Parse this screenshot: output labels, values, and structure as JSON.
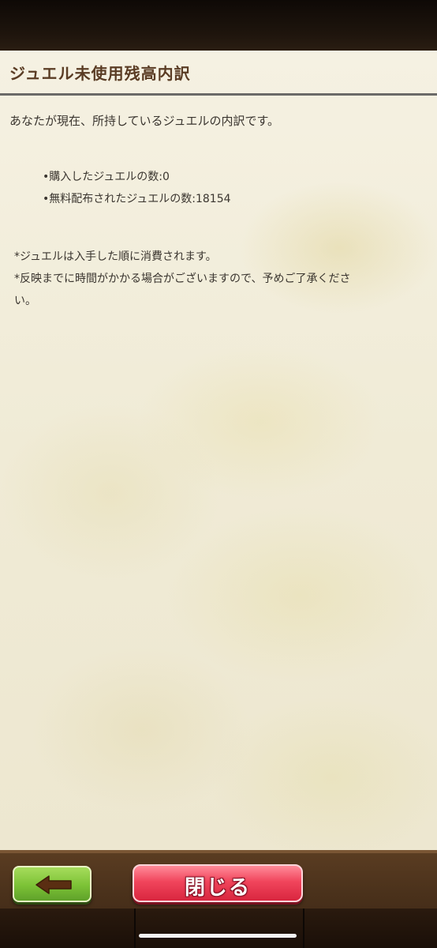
{
  "dialog": {
    "title": "ジュエル未使用残高内訳",
    "intro": "あなたが現在、所持しているジュエルの内訳です。",
    "breakdown": [
      {
        "text": "•購入したジュエルの数:0"
      },
      {
        "text": "•無料配布されたジュエルの数:18154"
      }
    ],
    "notes": [
      "*ジュエルは入手した順に消費されます。",
      "*反映までに時間がかかる場合がございますので、予めご了承くださ",
      "い。"
    ]
  },
  "footer": {
    "back_icon": "left-arrow-icon",
    "close_label": "閉じる"
  },
  "colors": {
    "title_text": "#5a3c24",
    "back_button": "#7cc236",
    "close_button": "#f1455c"
  }
}
